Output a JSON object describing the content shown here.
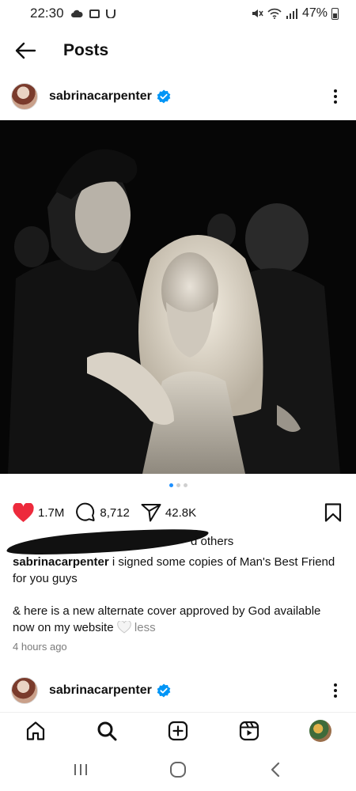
{
  "status_bar": {
    "time": "22:30",
    "battery": "47%"
  },
  "header": {
    "title": "Posts"
  },
  "posts": [
    {
      "username": "sabrinacarpenter",
      "likes": "1.7M",
      "comments": "8,712",
      "shares": "42.8K",
      "liked_by_suffix": "d others",
      "caption_user": "sabrinacarpenter",
      "caption_line1": " i signed some copies of Man's Best Friend for you guys",
      "caption_line2": "& here is a new alternate cover approved by God available now on my website",
      "caption_less": " less",
      "timestamp": "4 hours ago"
    },
    {
      "username": "sabrinacarpenter"
    }
  ],
  "carousel": {
    "count": 3,
    "active": 0
  },
  "colors": {
    "verified": "#0095f6",
    "like": "#ed2a3c",
    "carousel_active": "#1e90ff"
  },
  "bottom_nav": [
    "home-icon",
    "search-icon",
    "create-icon",
    "reels-icon",
    "profile-avatar"
  ],
  "system_nav": [
    "recent-apps-icon",
    "home-circle-icon",
    "back-chevron-icon"
  ]
}
